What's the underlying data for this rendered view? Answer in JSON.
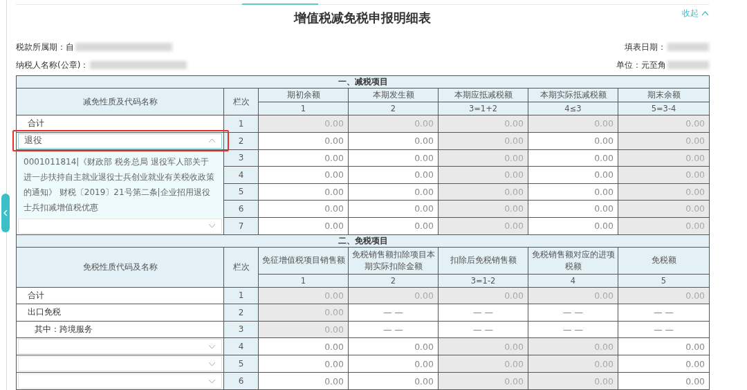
{
  "title": "增值税减免税申报明细表",
  "collapse_link": {
    "label": "收起"
  },
  "meta": [
    {
      "left": {
        "label": "税款所属期：自",
        "redacted": true
      },
      "right": {
        "label": "填表日期：",
        "redacted": true
      }
    },
    {
      "left": {
        "label": "纳税人名称(公章)：",
        "redacted": true
      },
      "right": {
        "label": "单位：元至角",
        "redacted": true
      }
    }
  ],
  "sections": [
    {
      "title": "一、减税项目",
      "name_header": "减免性质及代码名称",
      "no_header": "栏次",
      "columns": [
        {
          "label": "期初余额",
          "formula": "1"
        },
        {
          "label": "本期发生额",
          "formula": "2"
        },
        {
          "label": "本期应抵减税额",
          "formula": "3=1+2"
        },
        {
          "label": "本期实际抵减税额",
          "formula": "4≤3"
        },
        {
          "label": "期末余额",
          "formula": "5=3-4"
        }
      ],
      "rows": [
        {
          "name": {
            "kind": "text",
            "text": "合计"
          },
          "no": "1",
          "cells": [
            {
              "value": "0.00",
              "disabled": true
            },
            {
              "value": "0.00",
              "disabled": true
            },
            {
              "value": "0.00",
              "disabled": true
            },
            {
              "value": "0.00",
              "disabled": true
            },
            {
              "value": "0.00",
              "disabled": true
            }
          ]
        },
        {
          "name": {
            "kind": "select",
            "value": "退役",
            "expanded": true,
            "highlighted": true,
            "options": [
              "0001011814|《财政部 税务总局 退役军人部关于进一步扶持自主就业退役士兵创业就业有关税收政策的通知》 财税〔2019〕21号第二条|企业招用退役士兵扣减增值税优惠"
            ]
          },
          "no": "2",
          "cells": [
            {
              "value": "0.00",
              "disabled": false
            },
            {
              "value": "0.00",
              "disabled": false
            },
            {
              "value": "0.00",
              "disabled": true
            },
            {
              "value": "0.00",
              "disabled": false
            },
            {
              "value": "0.00",
              "disabled": true
            }
          ]
        },
        {
          "name": {
            "kind": "covered"
          },
          "no": "3",
          "cells": [
            {
              "value": "0.00",
              "disabled": false
            },
            {
              "value": "0.00",
              "disabled": false
            },
            {
              "value": "0.00",
              "disabled": true
            },
            {
              "value": "0.00",
              "disabled": false
            },
            {
              "value": "0.00",
              "disabled": true
            }
          ]
        },
        {
          "name": {
            "kind": "covered"
          },
          "no": "4",
          "cells": [
            {
              "value": "0.00",
              "disabled": false
            },
            {
              "value": "0.00",
              "disabled": false
            },
            {
              "value": "0.00",
              "disabled": true
            },
            {
              "value": "0.00",
              "disabled": false
            },
            {
              "value": "0.00",
              "disabled": true
            }
          ]
        },
        {
          "name": {
            "kind": "covered"
          },
          "no": "5",
          "cells": [
            {
              "value": "0.00",
              "disabled": false
            },
            {
              "value": "0.00",
              "disabled": false
            },
            {
              "value": "0.00",
              "disabled": true
            },
            {
              "value": "0.00",
              "disabled": false
            },
            {
              "value": "0.00",
              "disabled": true
            }
          ]
        },
        {
          "name": {
            "kind": "covered"
          },
          "no": "6",
          "cells": [
            {
              "value": "0.00",
              "disabled": false
            },
            {
              "value": "0.00",
              "disabled": false
            },
            {
              "value": "0.00",
              "disabled": true
            },
            {
              "value": "0.00",
              "disabled": false
            },
            {
              "value": "0.00",
              "disabled": true
            }
          ]
        },
        {
          "name": {
            "kind": "select",
            "expanded": false
          },
          "no": "7",
          "cells": [
            {
              "value": "0.00",
              "disabled": false
            },
            {
              "value": "0.00",
              "disabled": false
            },
            {
              "value": "0.00",
              "disabled": true
            },
            {
              "value": "0.00",
              "disabled": false
            },
            {
              "value": "0.00",
              "disabled": true
            }
          ]
        }
      ]
    },
    {
      "title": "二、免税项目",
      "name_header": "免税性质代码及名称",
      "no_header": "栏次",
      "columns": [
        {
          "label": "免征增值税项目销售额",
          "formula": "1"
        },
        {
          "label": "免税销售额扣除项目本期实际扣除金额",
          "formula": "2"
        },
        {
          "label": "扣除后免税销售额",
          "formula": "3=1-2"
        },
        {
          "label": "免税销售额对应的进项税额",
          "formula": "4"
        },
        {
          "label": "免税额",
          "formula": "5"
        }
      ],
      "rows": [
        {
          "name": {
            "kind": "text",
            "text": "合计"
          },
          "no": "1",
          "cells": [
            {
              "value": "0.00",
              "disabled": true
            },
            {
              "value": "0.00",
              "disabled": true
            },
            {
              "value": "0.00",
              "disabled": true
            },
            {
              "value": "0.00",
              "disabled": true
            },
            {
              "value": "0.00",
              "disabled": true
            }
          ]
        },
        {
          "name": {
            "kind": "text",
            "text": "出口免税"
          },
          "no": "2",
          "cells": [
            {
              "value": "0.00",
              "disabled": true
            },
            {
              "kind": "na",
              "value": "— —",
              "disabled": false
            },
            {
              "kind": "na",
              "value": "— —",
              "disabled": false
            },
            {
              "kind": "na",
              "value": "— —",
              "disabled": false
            },
            {
              "kind": "na",
              "value": "— —",
              "disabled": false
            }
          ]
        },
        {
          "name": {
            "kind": "subtext",
            "text": "其中：跨境服务"
          },
          "no": "3",
          "cells": [
            {
              "value": "0.00",
              "disabled": true
            },
            {
              "kind": "na",
              "value": "— —",
              "disabled": false
            },
            {
              "kind": "na",
              "value": "— —",
              "disabled": false
            },
            {
              "kind": "na",
              "value": "— —",
              "disabled": false
            },
            {
              "kind": "na",
              "value": "— —",
              "disabled": false
            }
          ]
        },
        {
          "name": {
            "kind": "select",
            "expanded": false
          },
          "no": "4",
          "cells": [
            {
              "value": "0.00",
              "disabled": false
            },
            {
              "value": "0.00",
              "disabled": false
            },
            {
              "value": "0.00",
              "disabled": true
            },
            {
              "value": "0.00",
              "disabled": true
            },
            {
              "value": "0.00",
              "disabled": false
            }
          ]
        },
        {
          "name": {
            "kind": "select",
            "expanded": false
          },
          "no": "5",
          "cells": [
            {
              "value": "0.00",
              "disabled": false
            },
            {
              "value": "0.00",
              "disabled": false
            },
            {
              "value": "0.00",
              "disabled": true
            },
            {
              "value": "0.00",
              "disabled": true
            },
            {
              "value": "0.00",
              "disabled": false
            }
          ]
        },
        {
          "name": {
            "kind": "select",
            "expanded": false
          },
          "no": "6",
          "cells": [
            {
              "value": "0.00",
              "disabled": false
            },
            {
              "value": "0.00",
              "disabled": false
            },
            {
              "value": "0.00",
              "disabled": true
            },
            {
              "value": "0.00",
              "disabled": true
            },
            {
              "value": "0.00",
              "disabled": false
            }
          ]
        }
      ]
    }
  ]
}
